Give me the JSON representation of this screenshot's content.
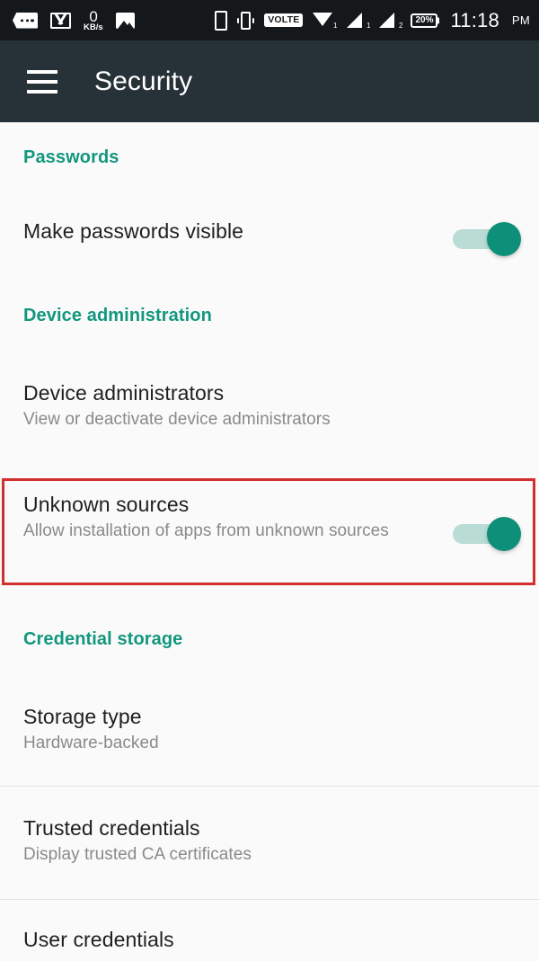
{
  "status_bar": {
    "time": "11:18",
    "ampm": "PM",
    "battery_percent": "20%",
    "network_speed_value": "0",
    "network_speed_unit": "KB/s",
    "volte_label": "VOLTE",
    "wifi_slot": "1",
    "signal1_slot": "1",
    "signal2_slot": "2",
    "icons": [
      "messaging-tag-icon",
      "gmail-icon",
      "network-speed-icon",
      "photos-icon",
      "sim-card-icon",
      "vibrate-icon",
      "volte-icon",
      "wifi-icon",
      "signal-1-icon",
      "signal-2-icon",
      "battery-icon"
    ]
  },
  "app_bar": {
    "title": "Security",
    "menu_icon": "hamburger-menu-icon",
    "background": "#263238"
  },
  "theme": {
    "accent_teal": "#12977e",
    "switch_on_thumb": "#0e8f79",
    "switch_on_track": "#b9dcd5",
    "highlight_red": "#d32f2f",
    "page_background": "#fafafa",
    "primary_text": "#1f1f1f",
    "secondary_text": "#8a8a8a"
  },
  "sections": {
    "passwords": {
      "header": "Passwords",
      "make_passwords_visible": {
        "title": "Make passwords visible",
        "switch_state": "on"
      }
    },
    "device_administration": {
      "header": "Device administration",
      "device_administrators": {
        "title": "Device administrators",
        "subtitle": "View or deactivate device administrators",
        "highlighted": true
      },
      "unknown_sources": {
        "title": "Unknown sources",
        "subtitle": "Allow installation of apps from unknown sources",
        "switch_state": "on"
      }
    },
    "credential_storage": {
      "header": "Credential storage",
      "storage_type": {
        "title": "Storage type",
        "subtitle": "Hardware-backed"
      },
      "trusted_credentials": {
        "title": "Trusted credentials",
        "subtitle": "Display trusted CA certificates"
      },
      "user_credentials": {
        "title": "User credentials"
      }
    }
  }
}
